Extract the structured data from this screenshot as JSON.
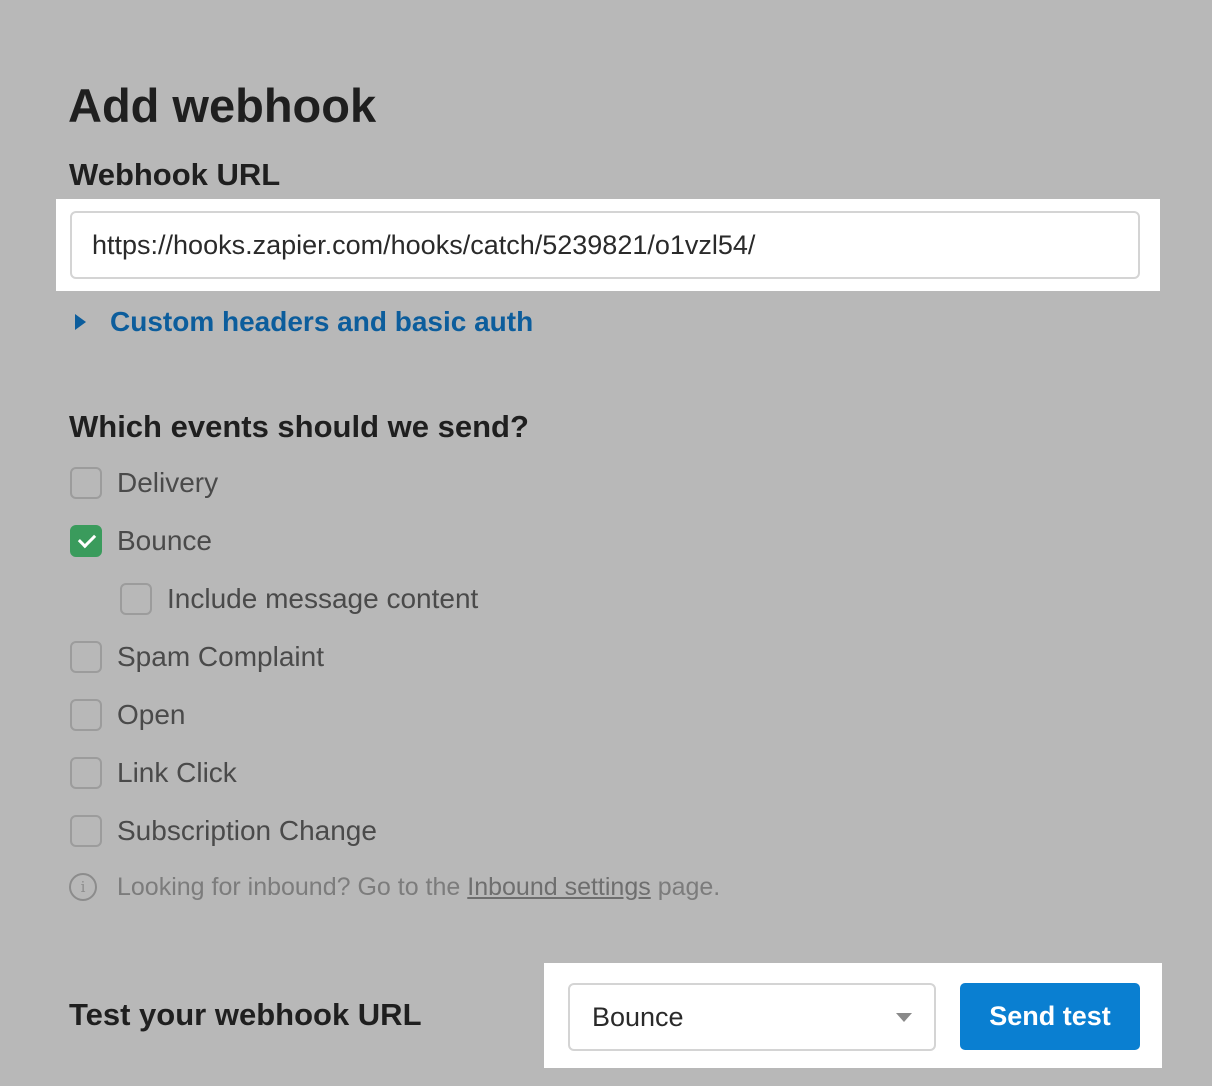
{
  "page": {
    "title": "Add webhook"
  },
  "webhook_url": {
    "label": "Webhook URL",
    "value": "https://hooks.zapier.com/hooks/catch/5239821/o1vzl54/"
  },
  "custom_headers": {
    "label": "Custom headers and basic auth",
    "icon": "caret-right-icon"
  },
  "events": {
    "label": "Which events should we send?",
    "items": [
      {
        "label": "Delivery",
        "checked": false
      },
      {
        "label": "Bounce",
        "checked": true
      },
      {
        "label": "Include message content",
        "checked": false
      },
      {
        "label": "Spam Complaint",
        "checked": false
      },
      {
        "label": "Open",
        "checked": false
      },
      {
        "label": "Link Click",
        "checked": false
      },
      {
        "label": "Subscription Change",
        "checked": false
      }
    ],
    "check_color": "#3a9b5c"
  },
  "inbound_note": {
    "prefix": "Looking for inbound? Go to the ",
    "link": "Inbound settings",
    "suffix": " page.",
    "icon": "info-icon"
  },
  "test": {
    "label": "Test your webhook URL",
    "selected_event": "Bounce",
    "button_label": "Send test",
    "button_color": "#0a7fd1"
  }
}
